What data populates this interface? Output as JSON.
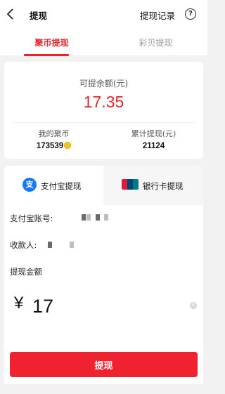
{
  "header": {
    "title": "提现",
    "records_label": "提现记录",
    "help_icon": "?"
  },
  "tabs": [
    {
      "label": "聚币提现",
      "active": true
    },
    {
      "label": "彩贝提现",
      "active": false
    }
  ],
  "balance": {
    "label": "可提余额(元)",
    "value": "17.35"
  },
  "stats": {
    "coins_label": "我的聚币",
    "coins_value": "173539",
    "total_label": "累计提现(元)",
    "total_value": "21124"
  },
  "methods": [
    {
      "label": "支付宝提现",
      "icon": "alipay-icon",
      "active": true
    },
    {
      "label": "银行卡提现",
      "icon": "unionpay-icon",
      "active": false
    }
  ],
  "form": {
    "account_label": "支付宝账号:",
    "payee_label": "收款人:",
    "amount_label": "提现金额",
    "currency": "¥",
    "amount_value": "17"
  },
  "submit_label": "提现",
  "colors": {
    "accent": "#e4262c",
    "alipay": "#1677ff"
  }
}
